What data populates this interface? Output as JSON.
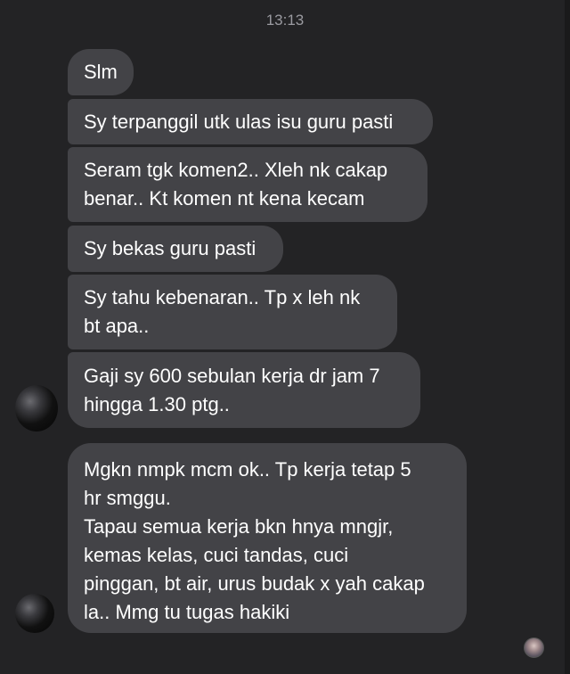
{
  "conversation": {
    "timestamp": "13:13",
    "messages": [
      {
        "text": "Slm"
      },
      {
        "text": "Sy terpanggil utk ulas isu guru pasti"
      },
      {
        "text": "Seram tgk komen2.. Xleh nk cakap\nbenar.. Kt komen nt kena kecam"
      },
      {
        "text": "Sy bekas guru pasti"
      },
      {
        "text": "Sy tahu kebenaran.. Tp x leh nk\nbt apa.."
      },
      {
        "text": "Gaji sy 600 sebulan kerja dr jam 7\nhingga 1.30 ptg.."
      },
      {
        "text": "Mgkn nmpk mcm ok.. Tp kerja tetap 5\nhr smggu.\nTapau semua kerja bkn hnya mngjr,\nkemas kelas, cuci tandas, cuci\npinggan, bt air, urus budak x yah cakap\nla.. Mmg tu tugas hakiki"
      }
    ]
  },
  "colors": {
    "background": "#232325",
    "bubble": "#434347",
    "text": "#ffffff",
    "timestamp": "#9a9aa0"
  }
}
